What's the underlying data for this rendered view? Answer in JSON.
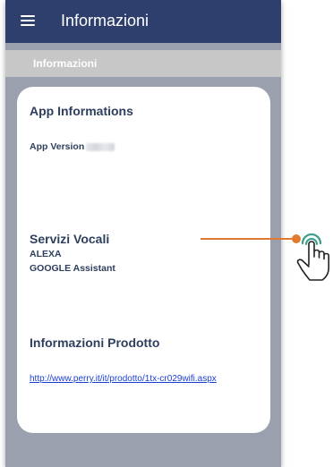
{
  "app_bar": {
    "title": "Informazioni",
    "menu_icon": "hamburger-menu-icon",
    "background_color": "#2e3f6e"
  },
  "sub_header": {
    "label": "Informazioni"
  },
  "card": {
    "app_info": {
      "heading": "App Informations",
      "version_label": "App Version"
    },
    "voice_services": {
      "heading": "Servizi Vocali",
      "items": [
        "ALEXA",
        "GOOGLE Assistant"
      ]
    },
    "product_info": {
      "heading": "Informazioni Prodotto",
      "link": "http://www.perry.it/it/prodotto/1tx-cr029wifi.aspx"
    }
  },
  "annotation": {
    "icon": "tap-hand-icon",
    "color": "#e07a2f"
  }
}
